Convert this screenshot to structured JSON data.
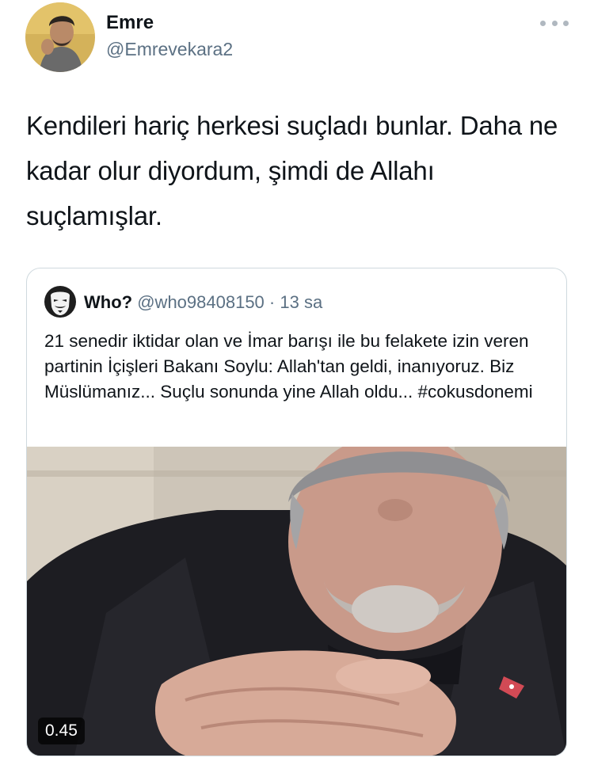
{
  "author": {
    "display_name": "Emre",
    "handle": "@Emrevekara2"
  },
  "more_icon": "more-horizontal-icon",
  "tweet_text": "Kendileri hariç herkesi suçladı bunlar. Daha ne kadar olur diyordum, şimdi de Allahı suçlamışlar.",
  "quoted": {
    "display_name": "Who?",
    "handle": "@who98408150",
    "separator": "·",
    "time": "13 sa",
    "text": "21 senedir iktidar olan ve İmar barışı ile bu felakete izin veren partinin İçişleri Bakanı Soylu: Allah'tan geldi, inanıyoruz. Biz Müslümanız... Suçlu sonunda yine Allah oldu... #cokusdonemi",
    "video": {
      "duration": "0.45"
    }
  },
  "colors": {
    "text": "#0f1419",
    "secondary": "#5b7083",
    "border": "#cfd9de"
  }
}
